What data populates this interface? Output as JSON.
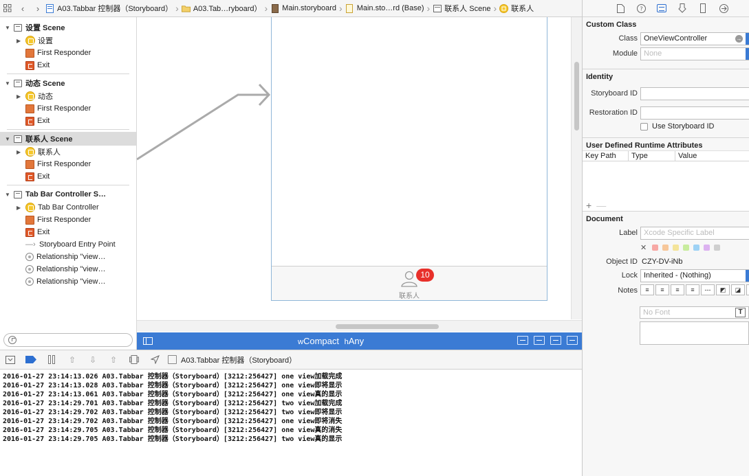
{
  "jumpbar": {
    "crumbs": [
      {
        "label": "A03.Tabbar 控制器（Storyboard）",
        "icon": "project-icon"
      },
      {
        "label": "A03.Tab…ryboard）",
        "icon": "folder-icon"
      },
      {
        "label": "Main.storyboard",
        "icon": "storyboard-file-icon"
      },
      {
        "label": "Main.sto…rd (Base)",
        "icon": "file-icon"
      },
      {
        "label": "联系人 Scene",
        "icon": "scene-icon"
      },
      {
        "label": "联系人",
        "icon": "view-controller-icon"
      }
    ]
  },
  "outline": {
    "scenes": [
      {
        "title": "设置 Scene",
        "items": [
          "设置",
          "First Responder",
          "Exit"
        ]
      },
      {
        "title": "动态 Scene",
        "items": [
          "动态",
          "First Responder",
          "Exit"
        ]
      },
      {
        "title": "联系人 Scene",
        "items": [
          "联系人",
          "First Responder",
          "Exit"
        ]
      },
      {
        "title": "Tab Bar Controller S…",
        "items": [
          "Tab Bar Controller",
          "First Responder",
          "Exit",
          "Storyboard Entry Point",
          "Relationship \"view…",
          "Relationship \"view…",
          "Relationship \"view…"
        ]
      }
    ]
  },
  "canvas": {
    "tab_item_label": "联系人",
    "tab_badge": "10"
  },
  "sizebar": {
    "w_label": "w",
    "w_value": "Compact",
    "h_label": "h",
    "h_value": "Any"
  },
  "debugbar": {
    "target": "A03.Tabbar 控制器（Storyboard）"
  },
  "console": {
    "lines": [
      "2016-01-27 23:14:13.026 A03.Tabbar 控制器（Storyboard）[3212:256427] one view加载完成",
      "2016-01-27 23:14:13.028 A03.Tabbar 控制器（Storyboard）[3212:256427] one view即将显示",
      "2016-01-27 23:14:13.061 A03.Tabbar 控制器（Storyboard）[3212:256427] one view真的显示",
      "2016-01-27 23:14:29.701 A03.Tabbar 控制器（Storyboard）[3212:256427] two view加载完成",
      "2016-01-27 23:14:29.702 A03.Tabbar 控制器（Storyboard）[3212:256427] two view即将显示",
      "2016-01-27 23:14:29.702 A03.Tabbar 控制器（Storyboard）[3212:256427] one view即将消失",
      "2016-01-27 23:14:29.705 A03.Tabbar 控制器（Storyboard）[3212:256427] one view真的消失",
      "2016-01-27 23:14:29.705 A03.Tabbar 控制器（Storyboard）[3212:256427] two view真的显示"
    ]
  },
  "inspector": {
    "custom_class": {
      "title": "Custom Class",
      "class_label": "Class",
      "class_value": "OneViewController",
      "module_label": "Module",
      "module_placeholder": "None"
    },
    "identity": {
      "title": "Identity",
      "storyboard_id_label": "Storyboard ID",
      "restoration_id_label": "Restoration ID",
      "use_storyboard_id": "Use Storyboard ID"
    },
    "rta": {
      "title": "User Defined Runtime Attributes",
      "columns": [
        "Key Path",
        "Type",
        "Value"
      ],
      "add": "+",
      "remove": "—"
    },
    "document": {
      "title": "Document",
      "label_label": "Label",
      "label_placeholder": "Xcode Specific Label",
      "swatch_clear": "✕",
      "swatches": [
        "#f7a8a4",
        "#f7c79a",
        "#f4e49a",
        "#c8ec9e",
        "#9ed2f5",
        "#dcb2f0",
        "#cfcfcf"
      ],
      "object_id_label": "Object ID",
      "object_id_value": "CZY-DV-iNb",
      "lock_label": "Lock",
      "lock_value": "Inherited - (Nothing)",
      "notes_label": "Notes",
      "font_placeholder": "No Font",
      "font_button": "T"
    }
  },
  "colors": {
    "accent": "#3b7bd4",
    "badge": "#e8302a"
  }
}
